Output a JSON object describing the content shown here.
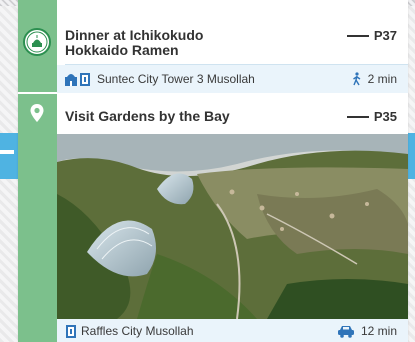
{
  "items": [
    {
      "title_line1": "Dinner at Ichikokudo",
      "title_line2": "Hokkaido Ramen",
      "page_ref": "P37",
      "prayer_location": "Suntec City Tower 3 Musollah",
      "travel_time": "2 min",
      "travel_mode_icon": "walking-person-icon"
    },
    {
      "title": "Visit Gardens by the Bay",
      "page_ref": "P35",
      "prayer_location": "Raffles City Musollah",
      "travel_time": "12 min",
      "travel_mode_icon": "car-icon"
    }
  ],
  "colors": {
    "rail_green": "#7cc08c",
    "accent_blue": "#4fb3e2",
    "info_bar_bg": "#eaf4fb",
    "icon_blue": "#2f74b9"
  }
}
